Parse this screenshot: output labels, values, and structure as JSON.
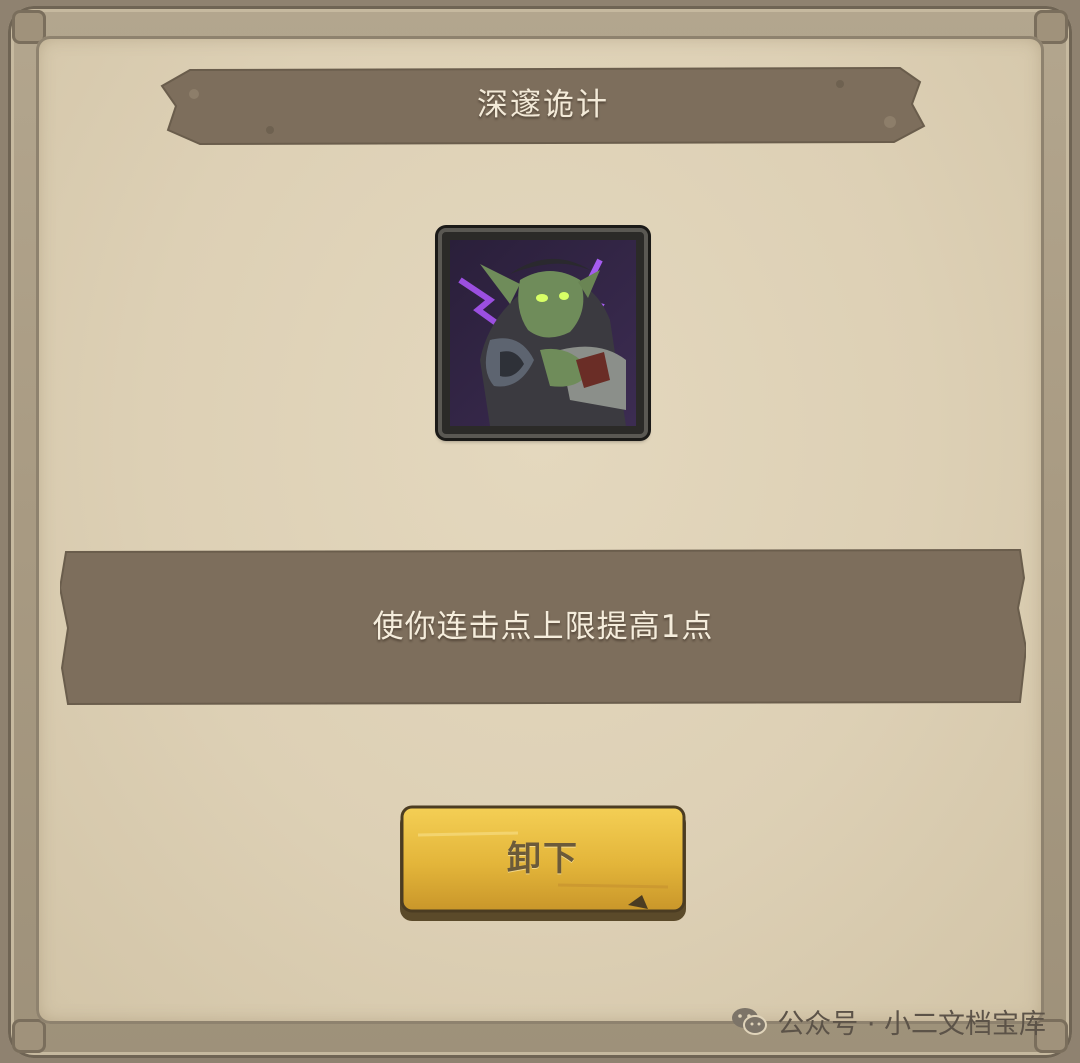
{
  "dialog": {
    "title": "深邃诡计",
    "skill_icon": "goblin-rogue-portrait-icon",
    "description": "使你连击点上限提高1点",
    "unequip_label": "卸下"
  },
  "watermark": {
    "icon": "wechat-icon",
    "text": "公众号 · 小二文档宝库"
  },
  "colors": {
    "parchment": "#ddd0b5",
    "banner_brown": "#7d6e5c",
    "button_gold": "#e0b43a",
    "frame_tan": "#a89a82"
  }
}
